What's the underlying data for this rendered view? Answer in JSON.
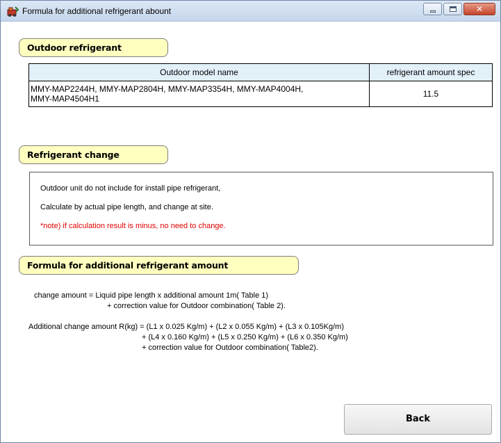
{
  "window": {
    "title": "Formula for additional refrigerant abount",
    "app_icon": "refrigerant-app-icon",
    "minimize_icon": "minimize-icon",
    "maximize_icon": "maximize-icon",
    "close_icon": "close-icon",
    "close_glyph": "✕"
  },
  "sections": {
    "outdoor_refrigerant": "Outdoor refrigerant",
    "refrigerant_change": "Refrigerant change",
    "formula": "Formula for additional refrigerant amount"
  },
  "table": {
    "headers": [
      "Outdoor model name",
      "refrigerant amount spec"
    ],
    "rows": [
      {
        "models_line1": "MMY-MAP2244H, MMY-MAP2804H, MMY-MAP3354H, MMY-MAP4004H,",
        "models_line2": "MMY-MAP4504H1",
        "spec": "11.5"
      }
    ]
  },
  "notes": {
    "line1": "Outdoor unit do not include for install pipe refrigerant,",
    "line2": "Calculate by actual pipe length, and change at site.",
    "line3": "*note) if calculation result is minus, no need to change."
  },
  "formula": {
    "change_line1": "change amount = Liquid pipe length x additional amount 1m( Table 1)",
    "change_line2": "+ correction value for Outdoor combination( Table 2).",
    "additional_line1": "Additional change amount R(kg) = (L1 x 0.025 Kg/m) + (L2 x 0.055 Kg/m) + (L3 x 0.105Kg/m)",
    "additional_line2": "+ (L4 x 0.160 Kg/m) + (L5 x 0.250 Kg/m) + (L6 x 0.350 Kg/m)",
    "additional_line3": "+ correction value for Outdoor combination( Table2)."
  },
  "buttons": {
    "back": "Back"
  },
  "colors": {
    "section_label_bg": "#ffffc0",
    "table_header_bg": "#e2f0f8",
    "note_red": "#e00000"
  }
}
